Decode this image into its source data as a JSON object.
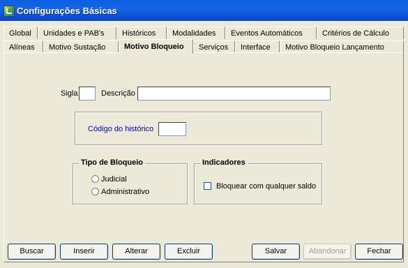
{
  "window": {
    "title": "Configurações Básicas"
  },
  "tabs_back": [
    "Global",
    "Unidades e PAB's",
    "Históricos",
    "Modalidades",
    "Eventos Automáticos",
    "Critérios de Cálculo"
  ],
  "tabs_front": [
    "Alíneas",
    "Motivo Sustação",
    "Motivo Bloqueio",
    "Serviços",
    "Interface",
    "Motivo Bloqueio Lançamento"
  ],
  "active_tab": "Motivo Bloqueio",
  "form": {
    "sigla_label": "Sigla",
    "sigla_value": "",
    "descricao_label": "Descrição",
    "descricao_value": "",
    "codigo_historico_label": "Código do histórico",
    "codigo_historico_value": ""
  },
  "tipo_bloqueio": {
    "legend": "Tipo de Bloqueio",
    "options": [
      "Judicial",
      "Administrativo"
    ]
  },
  "indicadores": {
    "legend": "Indicadores",
    "checkbox_label": "Bloquear com qualquer saldo",
    "checked": false
  },
  "buttons": {
    "buscar": "Buscar",
    "inserir": "Inserir",
    "alterar": "Alterar",
    "excluir": "Excluir",
    "salvar": "Salvar",
    "abandonar": "Abandonar",
    "fechar": "Fechar"
  },
  "colors": {
    "link_blue": "#0000cc",
    "title_bar": "#0a5fe0"
  }
}
